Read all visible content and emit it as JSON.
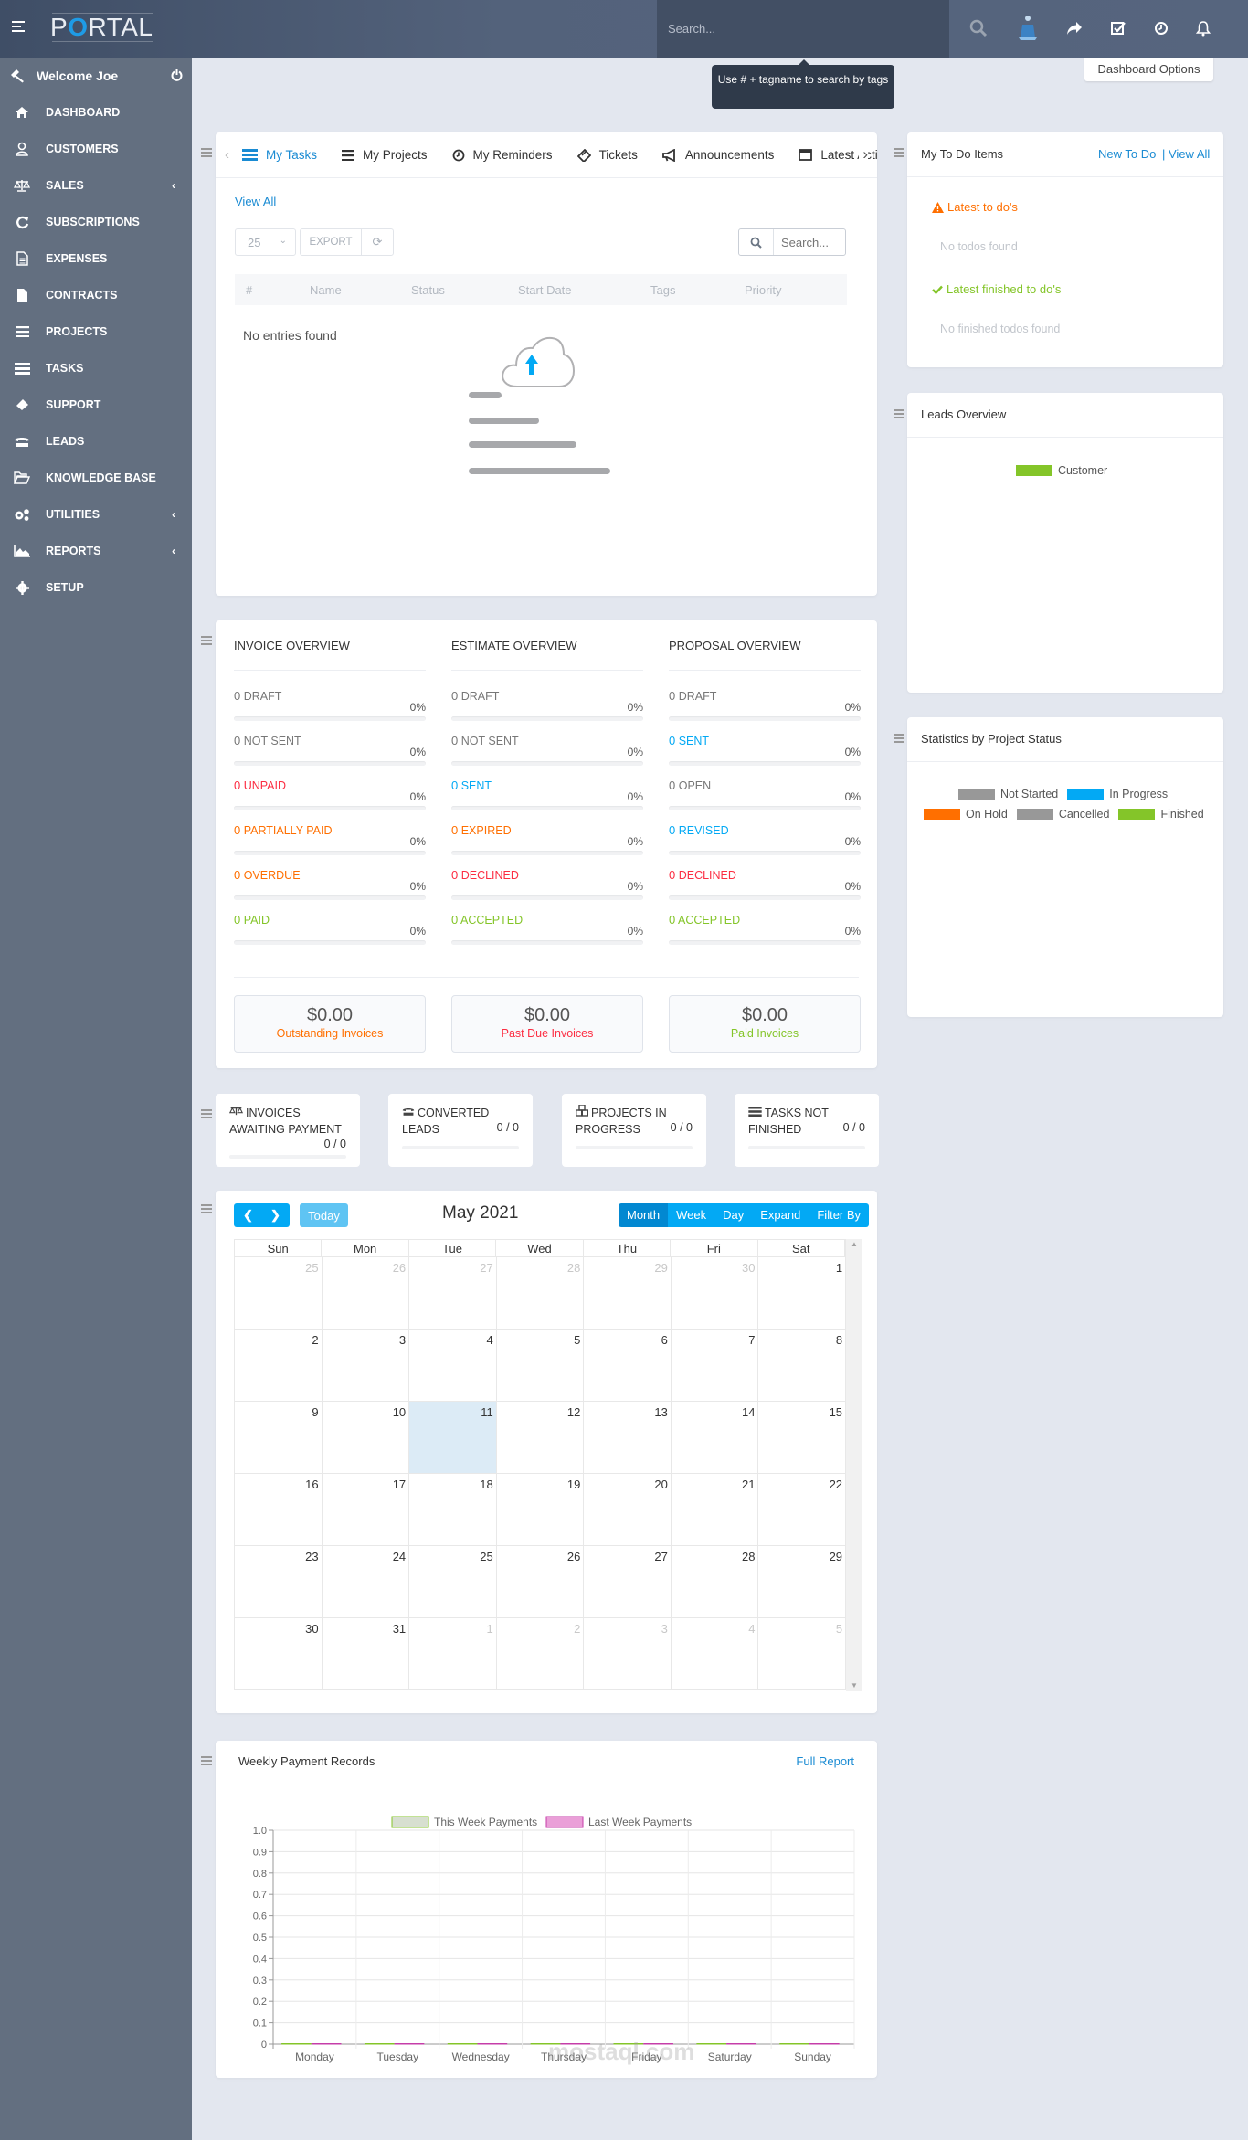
{
  "header": {
    "app_name_pre": "P",
    "app_name_o": "O",
    "app_name_post": "RTAL",
    "search_placeholder": "Search...",
    "search_tooltip": "Use # + tagname to search by tags",
    "dashboard_options": "Dashboard Options"
  },
  "sidebar": {
    "welcome": "Welcome Joe",
    "items": [
      {
        "label": "DASHBOARD",
        "icon": "home-icon",
        "chevron": false
      },
      {
        "label": "CUSTOMERS",
        "icon": "user-icon",
        "chevron": false
      },
      {
        "label": "SALES",
        "icon": "balance-scale-icon",
        "chevron": true
      },
      {
        "label": "SUBSCRIPTIONS",
        "icon": "refresh-icon",
        "chevron": false
      },
      {
        "label": "EXPENSES",
        "icon": "file-text-icon",
        "chevron": false
      },
      {
        "label": "CONTRACTS",
        "icon": "file-icon",
        "chevron": false
      },
      {
        "label": "PROJECTS",
        "icon": "bars-icon",
        "chevron": false
      },
      {
        "label": "TASKS",
        "icon": "tasks-icon",
        "chevron": false
      },
      {
        "label": "SUPPORT",
        "icon": "ticket-icon",
        "chevron": false
      },
      {
        "label": "LEADS",
        "icon": "tty-icon",
        "chevron": false
      },
      {
        "label": "KNOWLEDGE BASE",
        "icon": "folder-open-icon",
        "chevron": false
      },
      {
        "label": "UTILITIES",
        "icon": "cogs-icon",
        "chevron": true
      },
      {
        "label": "REPORTS",
        "icon": "area-chart-icon",
        "chevron": true
      },
      {
        "label": "SETUP",
        "icon": "cog-icon",
        "chevron": false
      }
    ]
  },
  "tasks_widget": {
    "tabs": [
      {
        "label": "My Tasks",
        "icon": "tasks-icon",
        "active": true
      },
      {
        "label": "My Projects",
        "icon": "bars-icon",
        "active": false
      },
      {
        "label": "My Reminders",
        "icon": "clock-icon",
        "active": false
      },
      {
        "label": "Tickets",
        "icon": "ticket-icon",
        "active": false
      },
      {
        "label": "Announcements",
        "icon": "bullhorn-icon",
        "active": false
      },
      {
        "label": "Latest Activity",
        "icon": "window-icon",
        "active": false
      }
    ],
    "view_all": "View All",
    "page_length": "25",
    "export": "EXPORT",
    "search_placeholder": "Search...",
    "columns": [
      "#",
      "Name",
      "Status",
      "Start Date",
      "Tags",
      "Priority"
    ],
    "empty": "No entries found"
  },
  "overview": {
    "columns": [
      {
        "title": "INVOICE OVERVIEW",
        "rows": [
          {
            "count": "0",
            "label": "DRAFT",
            "pct": "0%",
            "color": "#777777",
            "progress": 0
          },
          {
            "count": "0",
            "label": "NOT SENT",
            "pct": "0%",
            "color": "#777777",
            "progress": 0
          },
          {
            "count": "0",
            "label": "UNPAID",
            "pct": "0%",
            "color": "#fc2d42",
            "progress": 0
          },
          {
            "count": "0",
            "label": "PARTIALLY PAID",
            "pct": "0%",
            "color": "#ff6f00",
            "progress": 0
          },
          {
            "count": "0",
            "label": "OVERDUE",
            "pct": "0%",
            "color": "#ff6f00",
            "progress": 0
          },
          {
            "count": "0",
            "label": "PAID",
            "pct": "0%",
            "color": "#84c529",
            "progress": 0
          }
        ]
      },
      {
        "title": "ESTIMATE OVERVIEW",
        "rows": [
          {
            "count": "0",
            "label": "DRAFT",
            "pct": "0%",
            "color": "#777777",
            "progress": 0
          },
          {
            "count": "0",
            "label": "NOT SENT",
            "pct": "0%",
            "color": "#777777",
            "progress": 0
          },
          {
            "count": "0",
            "label": "SENT",
            "pct": "0%",
            "color": "#03a9f4",
            "progress": 0
          },
          {
            "count": "0",
            "label": "EXPIRED",
            "pct": "0%",
            "color": "#ff6f00",
            "progress": 0
          },
          {
            "count": "0",
            "label": "DECLINED",
            "pct": "0%",
            "color": "#fc2d42",
            "progress": 0
          },
          {
            "count": "0",
            "label": "ACCEPTED",
            "pct": "0%",
            "color": "#84c529",
            "progress": 0
          }
        ]
      },
      {
        "title": "PROPOSAL OVERVIEW",
        "rows": [
          {
            "count": "0",
            "label": "DRAFT",
            "pct": "0%",
            "color": "#777777",
            "progress": 0
          },
          {
            "count": "0",
            "label": "SENT",
            "pct": "0%",
            "color": "#03a9f4",
            "progress": 0
          },
          {
            "count": "0",
            "label": "OPEN",
            "pct": "0%",
            "color": "#777777",
            "progress": 0
          },
          {
            "count": "0",
            "label": "REVISED",
            "pct": "0%",
            "color": "#03a9f4",
            "progress": 0
          },
          {
            "count": "0",
            "label": "DECLINED",
            "pct": "0%",
            "color": "#fc2d42",
            "progress": 0
          },
          {
            "count": "0",
            "label": "ACCEPTED",
            "pct": "0%",
            "color": "#84c529",
            "progress": 0
          }
        ]
      }
    ],
    "totals": [
      {
        "amount": "$0.00",
        "label": "Outstanding Invoices",
        "color": "#ff6f00"
      },
      {
        "amount": "$0.00",
        "label": "Past Due Invoices",
        "color": "#fc2d42"
      },
      {
        "amount": "$0.00",
        "label": "Paid Invoices",
        "color": "#84c529"
      }
    ]
  },
  "stats": [
    {
      "title": "INVOICES AWAITING PAYMENT",
      "value": "0 / 0",
      "icon": "balance-scale-icon",
      "progress": 0
    },
    {
      "title": "CONVERTED LEADS",
      "value": "0 / 0",
      "icon": "tty-icon",
      "progress": 0
    },
    {
      "title": "PROJECTS IN PROGRESS",
      "value": "0 / 0",
      "icon": "cubes-icon",
      "progress": 0
    },
    {
      "title": "TASKS NOT FINISHED",
      "value": "0 / 0",
      "icon": "tasks-icon",
      "progress": 0
    }
  ],
  "calendar": {
    "title": "May 2021",
    "today_label": "Today",
    "views": [
      "Month",
      "Week",
      "Day",
      "Expand",
      "Filter By"
    ],
    "active_view": "Month",
    "weekdays": [
      "Sun",
      "Mon",
      "Tue",
      "Wed",
      "Thu",
      "Fri",
      "Sat"
    ],
    "weeks": [
      [
        {
          "d": "25",
          "o": true
        },
        {
          "d": "26",
          "o": true
        },
        {
          "d": "27",
          "o": true
        },
        {
          "d": "28",
          "o": true
        },
        {
          "d": "29",
          "o": true
        },
        {
          "d": "30",
          "o": true
        },
        {
          "d": "1",
          "o": false
        }
      ],
      [
        {
          "d": "2",
          "o": false
        },
        {
          "d": "3",
          "o": false
        },
        {
          "d": "4",
          "o": false
        },
        {
          "d": "5",
          "o": false
        },
        {
          "d": "6",
          "o": false
        },
        {
          "d": "7",
          "o": false
        },
        {
          "d": "8",
          "o": false
        }
      ],
      [
        {
          "d": "9",
          "o": false
        },
        {
          "d": "10",
          "o": false
        },
        {
          "d": "11",
          "o": false,
          "today": true
        },
        {
          "d": "12",
          "o": false
        },
        {
          "d": "13",
          "o": false
        },
        {
          "d": "14",
          "o": false
        },
        {
          "d": "15",
          "o": false
        }
      ],
      [
        {
          "d": "16",
          "o": false
        },
        {
          "d": "17",
          "o": false
        },
        {
          "d": "18",
          "o": false
        },
        {
          "d": "19",
          "o": false
        },
        {
          "d": "20",
          "o": false
        },
        {
          "d": "21",
          "o": false
        },
        {
          "d": "22",
          "o": false
        }
      ],
      [
        {
          "d": "23",
          "o": false
        },
        {
          "d": "24",
          "o": false
        },
        {
          "d": "25",
          "o": false
        },
        {
          "d": "26",
          "o": false
        },
        {
          "d": "27",
          "o": false
        },
        {
          "d": "28",
          "o": false
        },
        {
          "d": "29",
          "o": false
        }
      ],
      [
        {
          "d": "30",
          "o": false
        },
        {
          "d": "31",
          "o": false
        },
        {
          "d": "1",
          "o": true
        },
        {
          "d": "2",
          "o": true
        },
        {
          "d": "3",
          "o": true
        },
        {
          "d": "4",
          "o": true
        },
        {
          "d": "5",
          "o": true
        }
      ]
    ]
  },
  "todo": {
    "title": "My To Do Items",
    "new_link": "New To Do",
    "view_all": "| View All",
    "latest_label": "Latest to do's",
    "latest_empty": "No todos found",
    "finished_label": "Latest finished to do's",
    "finished_empty": "No finished todos found"
  },
  "leads": {
    "title": "Leads Overview",
    "legend": [
      {
        "label": "Customer",
        "color": "#84c529"
      }
    ]
  },
  "project_stats": {
    "title": "Statistics by Project Status",
    "legend": [
      {
        "label": "Not Started",
        "color": "#989898"
      },
      {
        "label": "In Progress",
        "color": "#03a9f4"
      },
      {
        "label": "On Hold",
        "color": "#ff6f00"
      },
      {
        "label": "Cancelled",
        "color": "#989898"
      },
      {
        "label": "Finished",
        "color": "#84c529"
      }
    ]
  },
  "weekly": {
    "title": "Weekly Payment Records",
    "full_report": "Full Report"
  },
  "chart_data": {
    "type": "bar",
    "title": "Weekly Payment Records",
    "categories": [
      "Monday",
      "Tuesday",
      "Wednesday",
      "Thursday",
      "Friday",
      "Saturday",
      "Sunday"
    ],
    "series": [
      {
        "name": "This Week Payments",
        "values": [
          0,
          0,
          0,
          0,
          0,
          0,
          0
        ],
        "color": "#84c529"
      },
      {
        "name": "Last Week Payments",
        "values": [
          0,
          0,
          0,
          0,
          0,
          0,
          0
        ],
        "color": "#c53da9"
      }
    ],
    "yticks": [
      "0",
      "0.1",
      "0.2",
      "0.3",
      "0.4",
      "0.5",
      "0.6",
      "0.7",
      "0.8",
      "0.9",
      "1.0"
    ],
    "ylim": [
      0,
      1
    ],
    "grid": true,
    "legend": "top",
    "xlabel": "",
    "ylabel": ""
  },
  "watermark": "mostaql.com"
}
